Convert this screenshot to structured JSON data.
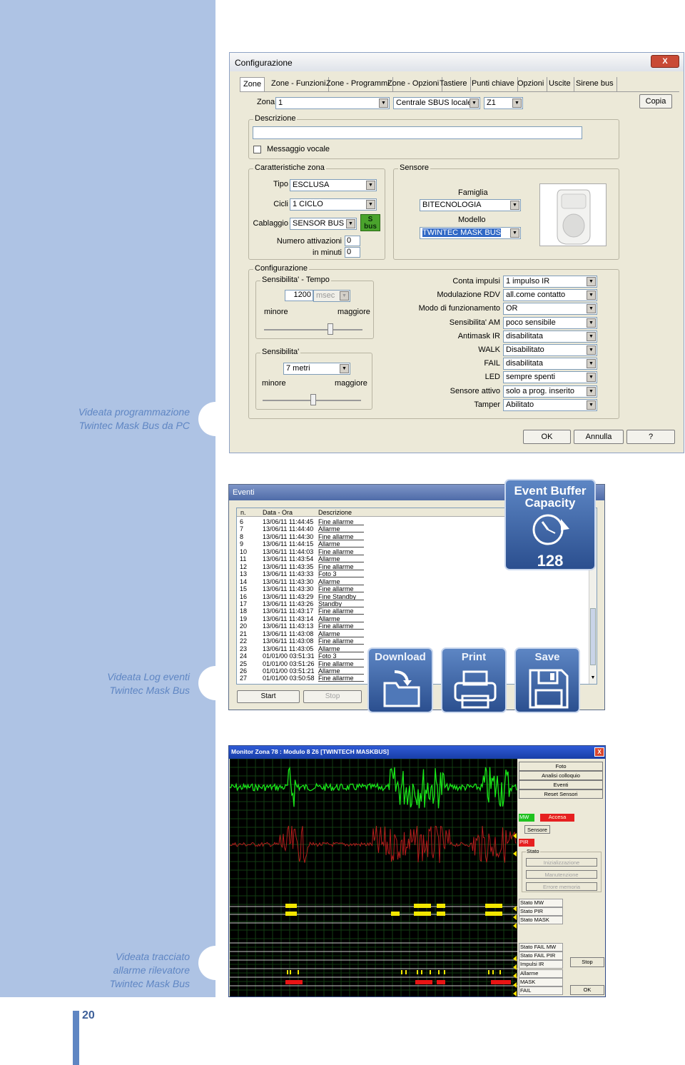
{
  "page": {
    "captions": [
      [
        "Videata programmazione",
        "Twintec Mask Bus da PC"
      ],
      [
        "Videata Log eventi",
        "Twintec Mask Bus"
      ],
      [
        "Videata tracciato",
        "allarme rilevatore",
        "Twintec Mask Bus"
      ]
    ],
    "page_number": "20",
    "colors": {
      "sidebar": "#aec3e4",
      "accent": "#5f86c3"
    }
  },
  "config": {
    "title": "Configurazione",
    "close": "X",
    "tabs": [
      "Zone",
      "Zone - Funzioni",
      "Zone - Programmi",
      "Zone - Opzioni",
      "Tastiere",
      "Punti chiave",
      "Opzioni",
      "Uscite",
      "Sirene bus"
    ],
    "zona_label": "Zona",
    "zona_value": "1",
    "centrale_value": "Centrale SBUS locale",
    "z_value": "Z1",
    "copia": "Copia",
    "descrizione_title": "Descrizione",
    "descrizione_value": "",
    "messaggio_vocale": "Messaggio vocale",
    "caratteristiche_title": "Caratteristiche zona",
    "tipo_label": "Tipo",
    "tipo_value": "ESCLUSA",
    "cicli_label": "Cicli",
    "cicli_value": "1 CICLO",
    "cablaggio_label": "Cablaggio",
    "cablaggio_value": "SENSOR BUS",
    "sbus_badge": "S bus",
    "numero_attivazioni_label": "Numero attivazioni",
    "numero_attivazioni_value": "0",
    "in_minuti_label": "in minuti",
    "in_minuti_value": "0",
    "sensore_title": "Sensore",
    "famiglia_label": "Famiglia",
    "famiglia_value": "BITECNOLOGIA",
    "modello_label": "Modello",
    "modello_value": "TWINTEC MASK BUS",
    "configurazione_title": "Configurazione",
    "sens_tempo_title": "Sensibilita' - Tempo",
    "sens_tempo_value": "1200",
    "sens_tempo_unit": "msec",
    "minore": "minore",
    "maggiore": "maggiore",
    "sensibilita_title": "Sensibilita'",
    "sensibilita_value": "7 metri",
    "options": [
      {
        "label": "Conta impulsi",
        "value": "1 impulso IR"
      },
      {
        "label": "Modulazione RDV",
        "value": "all.come contatto"
      },
      {
        "label": "Modo di funzionamento",
        "value": "OR"
      },
      {
        "label": "Sensibilita' AM",
        "value": "poco sensibile"
      },
      {
        "label": "Antimask IR",
        "value": "disabilitata"
      },
      {
        "label": "WALK",
        "value": "Disabilitato"
      },
      {
        "label": "FAIL",
        "value": "disabilitata"
      },
      {
        "label": "LED",
        "value": "sempre spenti"
      },
      {
        "label": "Sensore attivo",
        "value": "solo a prog. inserito"
      },
      {
        "label": "Tamper",
        "value": "Abilitato"
      }
    ],
    "ok": "OK",
    "annulla": "Annulla",
    "help": "?"
  },
  "eventi": {
    "title": "Eventi",
    "headers": [
      "n.",
      "Data - Ora",
      "Descrizione"
    ],
    "rows": [
      [
        "6",
        "13/06/11 11:44:45",
        "Fine allarme"
      ],
      [
        "7",
        "13/06/11 11:44:40",
        "Allarme"
      ],
      [
        "8",
        "13/06/11 11:44:30",
        "Fine allarme"
      ],
      [
        "9",
        "13/06/11 11:44:15",
        "Allarme"
      ],
      [
        "10",
        "13/06/11 11:44:03",
        "Fine allarme"
      ],
      [
        "11",
        "13/06/11 11:43:54",
        "Allarme"
      ],
      [
        "12",
        "13/06/11 11:43:35",
        "Fine allarme"
      ],
      [
        "13",
        "13/06/11 11:43:33",
        "Foto 3"
      ],
      [
        "14",
        "13/06/11 11:43:30",
        "Allarme"
      ],
      [
        "15",
        "13/06/11 11:43:30",
        "Fine allarme"
      ],
      [
        "16",
        "13/06/11 11:43:29",
        "Fine Standby"
      ],
      [
        "17",
        "13/06/11 11:43:26",
        "Standby"
      ],
      [
        "18",
        "13/06/11 11:43:17",
        "Fine allarme"
      ],
      [
        "19",
        "13/06/11 11:43:14",
        "Allarme"
      ],
      [
        "20",
        "13/06/11 11:43:13",
        "Fine allarme"
      ],
      [
        "21",
        "13/06/11 11:43:08",
        "Allarme"
      ],
      [
        "22",
        "13/06/11 11:43:08",
        "Fine allarme"
      ],
      [
        "23",
        "13/06/11 11:43:05",
        "Allarme"
      ],
      [
        "24",
        "01/01/00 03:51:31",
        "Foto 3"
      ],
      [
        "25",
        "01/01/00 03:51:26",
        "Fine allarme"
      ],
      [
        "26",
        "01/01/00 03:51:21",
        "Allarme"
      ],
      [
        "27",
        "01/01/00 03:50:58",
        "Fine allarme"
      ]
    ],
    "start": "Start",
    "stop": "Stop",
    "capacity_title": "Event Buffer Capacity",
    "capacity_value": "128",
    "download": "Download",
    "print": "Print",
    "save": "Save"
  },
  "monitor": {
    "title": "Monitor Zona 78 : Modulo 8 Z6 [TWINTECH MASKBUS]",
    "close": "X",
    "buttons": [
      "Foto",
      "Analisi colloquio",
      "Eventi",
      "Reset Sensori"
    ],
    "mw": "MW",
    "accesa": "Accesa",
    "sensore": "Sensore",
    "pir": "PIR",
    "stato": "Stato",
    "stato_buttons": [
      "Inizializzazione",
      "Manutenzione",
      "Errore memoria"
    ],
    "traces_a": [
      "Stato MW",
      "Stato PIR",
      "Stato MASK"
    ],
    "traces_b": [
      "Stato FAIL MW",
      "Stato FAIL PIR",
      "Impulsi IR",
      "Allarme",
      "MASK",
      "FAIL"
    ],
    "stop": "Stop",
    "ok": "OK",
    "colors": {
      "mw_trace": "#19e619",
      "pir_trace": "#b51c1c",
      "state": "#f2e600",
      "alarm": "#e81414"
    }
  }
}
